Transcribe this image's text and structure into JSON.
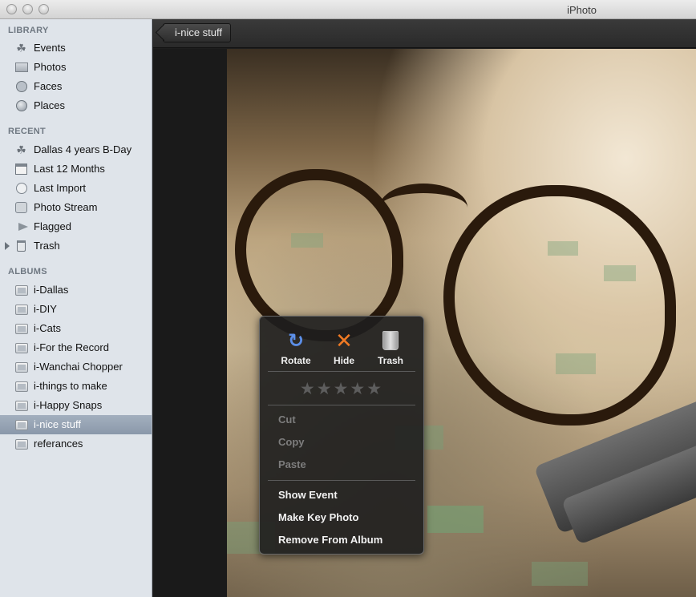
{
  "window": {
    "title": "iPhoto"
  },
  "sidebar": {
    "library": {
      "heading": "LIBRARY",
      "items": [
        {
          "label": "Events",
          "icon": "palm-icon"
        },
        {
          "label": "Photos",
          "icon": "photos-icon"
        },
        {
          "label": "Faces",
          "icon": "faces-icon"
        },
        {
          "label": "Places",
          "icon": "globe-icon"
        }
      ]
    },
    "recent": {
      "heading": "RECENT",
      "items": [
        {
          "label": "Dallas 4 years B-Day",
          "icon": "palm-icon"
        },
        {
          "label": "Last 12 Months",
          "icon": "calendar-icon"
        },
        {
          "label": "Last Import",
          "icon": "clock-icon"
        },
        {
          "label": "Photo Stream",
          "icon": "photo-stream-icon"
        },
        {
          "label": "Flagged",
          "icon": "flag-icon"
        },
        {
          "label": "Trash",
          "icon": "trash-icon"
        }
      ]
    },
    "albums": {
      "heading": "ALBUMS",
      "items": [
        {
          "label": "i-Dallas"
        },
        {
          "label": "i-DIY"
        },
        {
          "label": "i-Cats"
        },
        {
          "label": "i-For the Record"
        },
        {
          "label": "i-Wanchai Chopper"
        },
        {
          "label": "i-things to make"
        },
        {
          "label": "i-Happy Snaps"
        },
        {
          "label": "i-nice stuff",
          "selected": true
        },
        {
          "label": "referances"
        }
      ]
    }
  },
  "toolbar": {
    "back_label": "i-nice stuff"
  },
  "hud": {
    "actions": [
      {
        "label": "Rotate",
        "icon": "rotate-icon"
      },
      {
        "label": "Hide",
        "icon": "hide-x-icon"
      },
      {
        "label": "Trash",
        "icon": "trash-can-icon"
      }
    ],
    "stars": "★★★★★",
    "rating": 0,
    "menu": [
      {
        "label": "Cut",
        "enabled": false
      },
      {
        "label": "Copy",
        "enabled": false
      },
      {
        "label": "Paste",
        "enabled": false
      },
      {
        "label": "Show Event",
        "enabled": true
      },
      {
        "label": "Make Key Photo",
        "enabled": true
      },
      {
        "label": "Remove From Album",
        "enabled": true
      }
    ]
  }
}
